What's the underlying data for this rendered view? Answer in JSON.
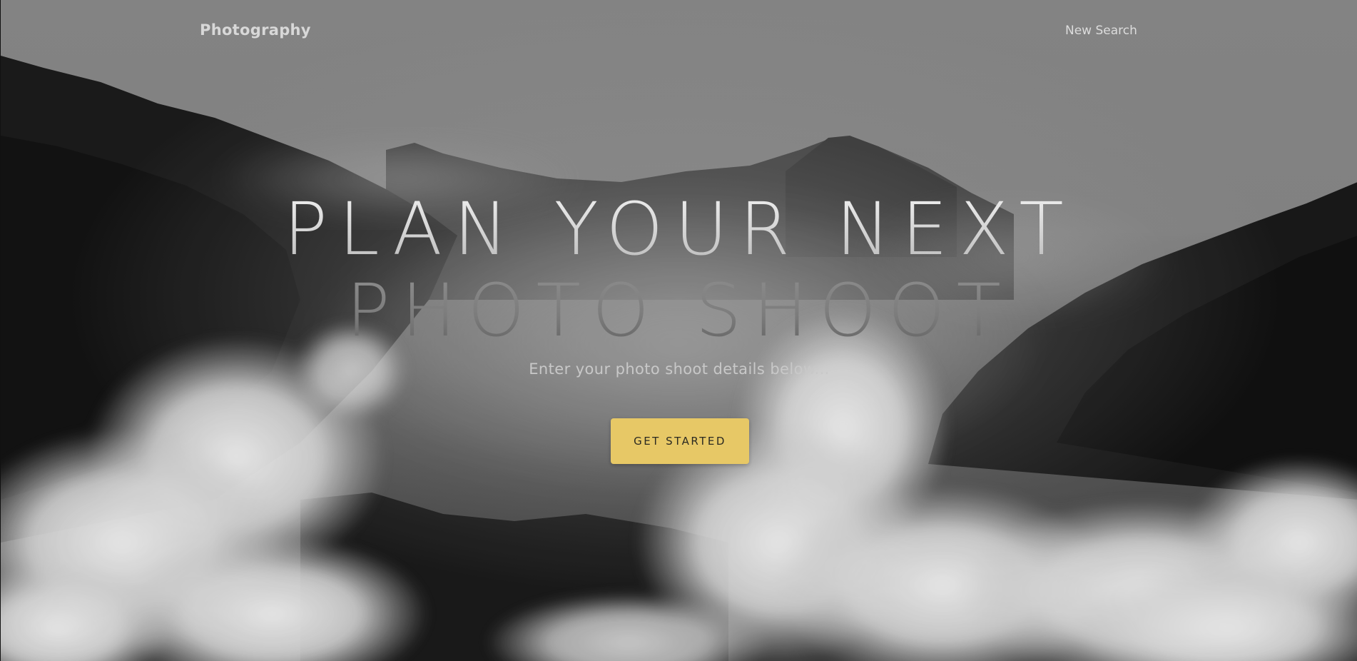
{
  "navbar": {
    "brand": "Photography",
    "link": "New Search"
  },
  "hero": {
    "headline_line1": "PLAN YOUR NEXT",
    "headline_line2": "PHOTO SHOOT",
    "subtitle": "Enter your photo shoot details below...",
    "cta_label": "GET STARTED",
    "background": "misty-forest-mountains-photo"
  },
  "colors": {
    "accent": "#e7c866",
    "heading": "#d9d9d9",
    "text": "#c8c8c8"
  }
}
